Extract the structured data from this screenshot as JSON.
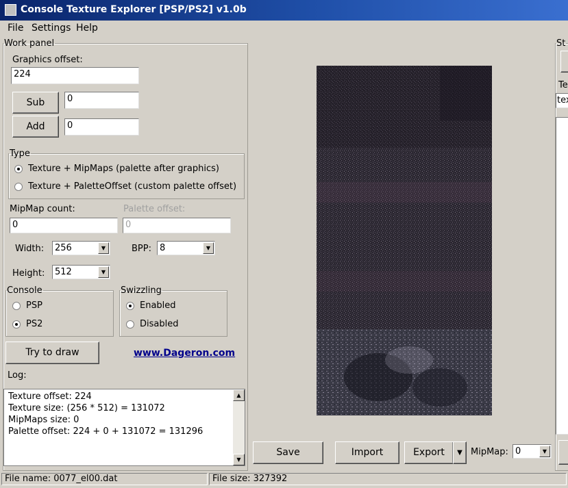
{
  "window": {
    "title": "Console Texture Explorer [PSP/PS2] v1.0b"
  },
  "menu": {
    "file": "File",
    "settings": "Settings",
    "help": "Help"
  },
  "work_panel": {
    "legend": "Work panel",
    "graphics_offset_label": "Graphics offset:",
    "graphics_offset_value": "224",
    "sub_label": "Sub",
    "sub_value": "0",
    "add_label": "Add",
    "add_value": "0",
    "type": {
      "legend": "Type",
      "option1": "Texture + MipMaps (palette after graphics)",
      "option2": "Texture + PaletteOffset (custom palette offset)",
      "selected": 1
    },
    "mipmap_count_label": "MipMap count:",
    "mipmap_count_value": "0",
    "palette_offset_label": "Palette offset:",
    "palette_offset_value": "0",
    "width_label": "Width:",
    "width_value": "256",
    "bpp_label": "BPP:",
    "bpp_value": "8",
    "height_label": "Height:",
    "height_value": "512",
    "console": {
      "legend": "Console",
      "psp": "PSP",
      "ps2": "PS2",
      "selected": "PS2"
    },
    "swizzling": {
      "legend": "Swizzling",
      "enabled": "Enabled",
      "disabled": "Disabled",
      "selected": "Enabled"
    },
    "try_to_draw": "Try to draw",
    "link": "www.Dageron.com",
    "log_label": "Log:",
    "log_lines": [
      "Texture offset: 224",
      "Texture size: (256 * 512) = 131072",
      "MipMaps size: 0",
      "Palette offset: 224 + 0 + 131072 = 131296"
    ]
  },
  "preview_toolbar": {
    "save": "Save",
    "import": "Import",
    "export": "Export",
    "mipmap_label": "MipMap:",
    "mipmap_value": "0"
  },
  "right_panel": {
    "legend_partial": "St",
    "label_partial": "Te",
    "input_partial": "tex"
  },
  "status": {
    "file_name": "File name: 0077_el00.dat",
    "file_size": "File size: 327392"
  }
}
